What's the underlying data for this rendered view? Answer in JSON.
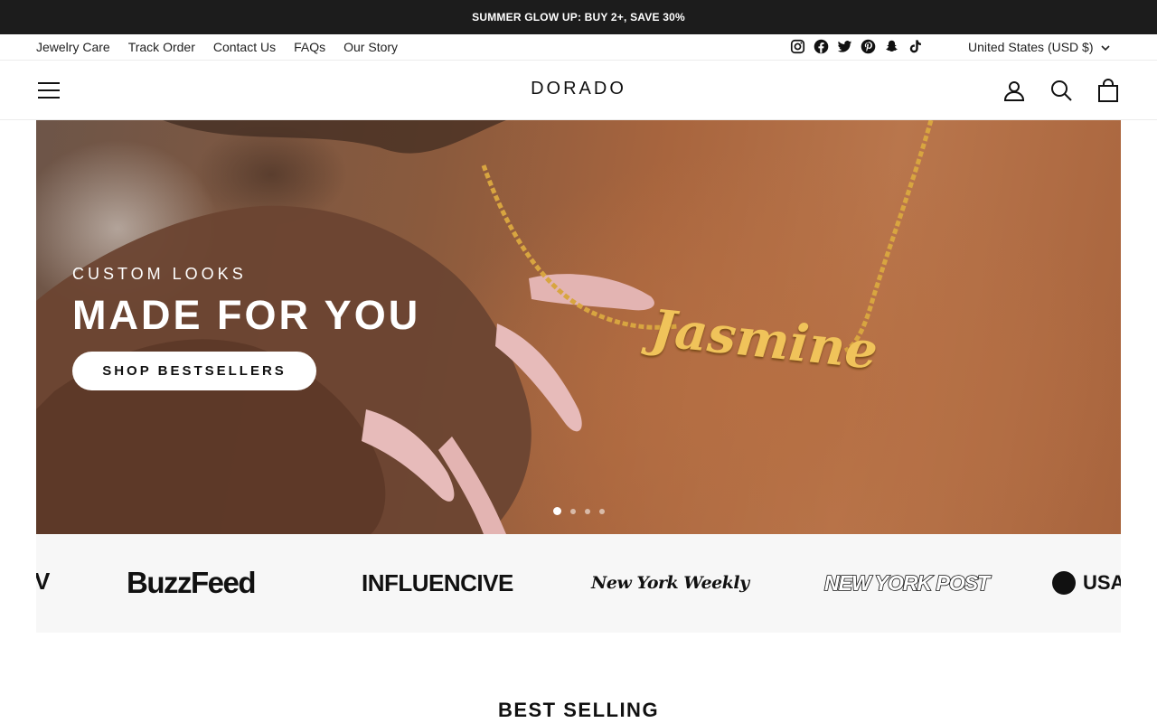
{
  "announcement": {
    "text": "SUMMER GLOW UP: BUY 2+, SAVE 30%"
  },
  "utility_nav": {
    "links": [
      "Jewelry Care",
      "Track Order",
      "Contact Us",
      "FAQs",
      "Our Story"
    ],
    "socials": [
      "instagram-icon",
      "facebook-icon",
      "twitter-icon",
      "pinterest-icon",
      "snapchat-icon",
      "tiktok-icon"
    ],
    "currency": "United States (USD $)"
  },
  "header": {
    "logo": "DORADO",
    "icons": [
      "menu-icon",
      "account-icon",
      "search-icon",
      "cart-icon"
    ]
  },
  "hero": {
    "kicker": "CUSTOM LOOKS",
    "title": "MADE FOR YOU",
    "button": "SHOP BESTSELLERS",
    "necklace_text": "Jasmine",
    "slides": 4,
    "active_slide": 1
  },
  "press": {
    "logos": [
      "BuzzFeed",
      "INFLUENCIVE",
      "New York Weekly",
      "NEW YORK POST",
      "USA"
    ],
    "edge_fragment": "V"
  },
  "best_selling": {
    "title": "BEST SELLING"
  },
  "colors": {
    "announcement_bg": "#1c1c1c",
    "press_bg": "#f7f7f7",
    "text": "#111111"
  }
}
